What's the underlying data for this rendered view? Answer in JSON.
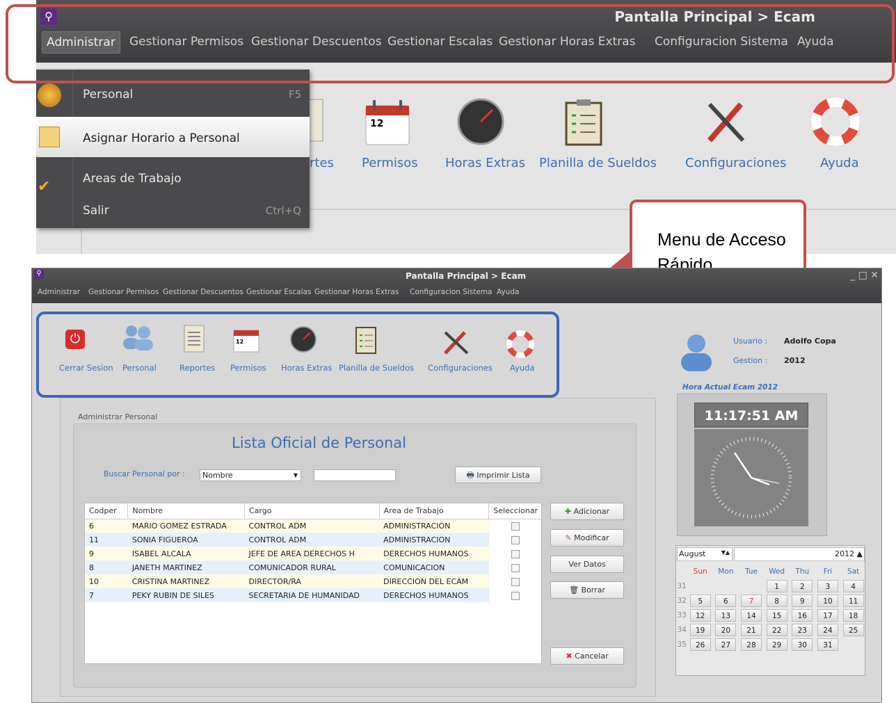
{
  "zoom": {
    "title": "Pantalla Principal  >  Ecam",
    "menu": [
      "Administrar",
      "Gestionar Permisos",
      "Gestionar Descuentos",
      "Gestionar Escalas",
      "Gestionar Horas Extras",
      "Configuracion Sistema",
      "Ayuda"
    ],
    "dropdown": [
      {
        "label": "Personal",
        "shortcut": "F5"
      },
      {
        "label": "Asignar Horario a Personal",
        "shortcut": ""
      },
      {
        "label": "Areas de Trabajo",
        "shortcut": ""
      },
      {
        "label": "Salir",
        "shortcut": "Ctrl+Q"
      }
    ],
    "icons": [
      "rtes",
      "Permisos",
      "Horas Extras",
      "Planilla de Sueldos",
      "Configuraciones",
      "Ayuda"
    ]
  },
  "callout": "Menu de Acceso Rápido",
  "app": {
    "title": "Pantalla Principal  >  Ecam",
    "menu": [
      "Administrar",
      "Gestionar Permisos",
      "Gestionar Descuentos",
      "Gestionar Escalas",
      "Gestionar Horas Extras",
      "Configuracion Sistema",
      "Ayuda"
    ],
    "quick": [
      "Cerrar Sesion",
      "Personal",
      "Reportes",
      "Permisos",
      "Horas Extras",
      "Planilla de Sueldos",
      "Configuraciones",
      "Ayuda"
    ],
    "user_label": "Usuario :",
    "user": "Adolfo Copa",
    "gestion_label": "Gestion :",
    "gestion": "2012",
    "hora_label": "Hora Actual  Ecam 2012",
    "time": "11:17:51 AM",
    "panel_title": "Administrar Personal",
    "list_title": "Lista  Oficial de Personal",
    "search_label": "Buscar  Personal por :",
    "search_select": "Nombre",
    "print": "Imprimir Lista",
    "columns": [
      "Codper",
      "Nombre",
      "Cargo",
      "Area de Trabajo",
      "Seleccionar"
    ],
    "rows": [
      [
        "6",
        "MARIO GOMEZ ESTRADA",
        "CONTROL ADM",
        "ADMINISTRACION"
      ],
      [
        "11",
        "SONIA  FIGUEROA",
        "CONTROL ADM",
        "ADMINISTRACION"
      ],
      [
        "9",
        "ISABEL ALCALA",
        "JEFE DE AREA DERECHOS H",
        "DERECHOS HUMANOS"
      ],
      [
        "8",
        "JANETH MARTINEZ",
        "COMUNICADOR RURAL",
        "COMUNICACION"
      ],
      [
        "10",
        "CRISTINA  MARTINEZ",
        "DIRECTOR/RA",
        "DIRECCION DEL ECAM"
      ],
      [
        "7",
        "PEKY RUBIN DE SILES",
        "SECRETARIA DE HUMANIDAD",
        "DERECHOS HUMANOS"
      ]
    ],
    "buttons": [
      "Adicionar",
      "Modificar",
      "Ver Datos",
      "Borrar",
      "Cancelar"
    ],
    "cal": {
      "month": "August",
      "year": "2012",
      "days": [
        "Sun",
        "Mon",
        "Tue",
        "Wed",
        "Thu",
        "Fri",
        "Sat"
      ],
      "weeks": [
        [
          "31",
          "",
          "",
          "",
          "1",
          "2",
          "3",
          "4"
        ],
        [
          "32",
          "5",
          "6",
          "7",
          "8",
          "9",
          "10",
          "11"
        ],
        [
          "33",
          "12",
          "13",
          "14",
          "15",
          "16",
          "17",
          "18"
        ],
        [
          "34",
          "19",
          "20",
          "21",
          "22",
          "23",
          "24",
          "25"
        ],
        [
          "35",
          "26",
          "27",
          "28",
          "29",
          "30",
          "31",
          ""
        ]
      ]
    }
  }
}
